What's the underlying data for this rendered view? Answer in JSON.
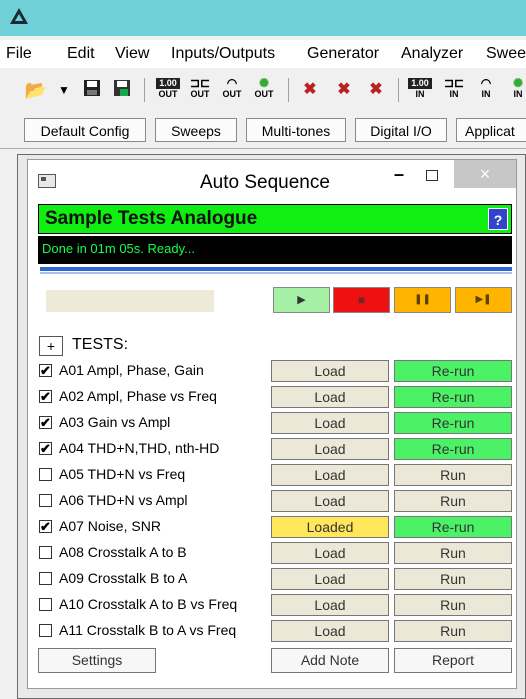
{
  "menu": [
    "File",
    "Edit",
    "View",
    "Inputs/Outputs",
    "Generator",
    "Analyzer",
    "Swee"
  ],
  "toolbar_labels": {
    "out": "OUT",
    "in": "IN",
    "level": "1.00"
  },
  "tabs": [
    "Default Config",
    "Sweeps",
    "Multi-tones",
    "Digital I/O",
    "Applicat"
  ],
  "window": {
    "title": "Auto Sequence",
    "minimize": "–",
    "close": "×"
  },
  "sequence": {
    "name": "Sample Tests Analogue",
    "help": "?",
    "status": "Done in 01m 05s.  Ready..."
  },
  "controls": {
    "play": "▶",
    "stop": "■",
    "pause": "❚❚",
    "step": "▶❚"
  },
  "tests_header": {
    "toggle": "+",
    "label": "TESTS:"
  },
  "tests": [
    {
      "checked": "✔",
      "label": "A01 Ampl, Phase, Gain",
      "load": "Load",
      "run": "Re-run"
    },
    {
      "checked": "✔",
      "label": "A02 Ampl, Phase vs Freq",
      "load": "Load",
      "run": "Re-run"
    },
    {
      "checked": "✔",
      "label": "A03 Gain vs Ampl",
      "load": "Load",
      "run": "Re-run"
    },
    {
      "checked": "✔",
      "label": "A04 THD+N,THD, nth-HD",
      "load": "Load",
      "run": "Re-run"
    },
    {
      "checked": "",
      "label": "A05 THD+N vs Freq",
      "load": "Load",
      "run": "Run"
    },
    {
      "checked": "",
      "label": "A06 THD+N vs Ampl",
      "load": "Load",
      "run": "Run"
    },
    {
      "checked": "✔",
      "label": "A07 Noise, SNR",
      "load": "Loaded",
      "run": "Re-run"
    },
    {
      "checked": "",
      "label": "A08 Crosstalk A to B",
      "load": "Load",
      "run": "Run"
    },
    {
      "checked": "",
      "label": "A09 Crosstalk B to A",
      "load": "Load",
      "run": "Run"
    },
    {
      "checked": "",
      "label": "A10 Crosstalk A to B vs Freq",
      "load": "Load",
      "run": "Run"
    },
    {
      "checked": "",
      "label": "A11 Crosstalk B to A vs Freq",
      "load": "Load",
      "run": "Run"
    }
  ],
  "bottom": {
    "settings": "Settings",
    "add_note": "Add Note",
    "report": "Report"
  },
  "colors": {
    "titlebar": "#6fd0d8",
    "header_green": "#11ee11",
    "rerun_green": "#4cf266",
    "loaded_yellow": "#ffe65a",
    "status_bg": "#000000",
    "status_text": "#14ff4a"
  }
}
